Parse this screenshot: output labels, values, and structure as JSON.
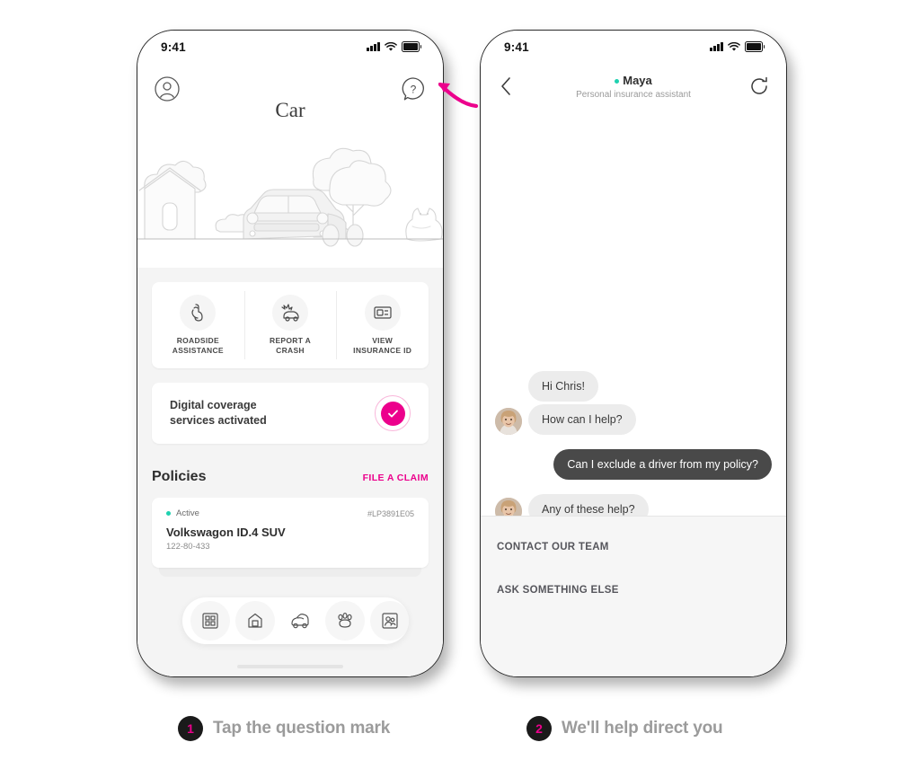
{
  "accent": {
    "pink": "#ec008c",
    "teal": "#1fd1b0",
    "dark": "#494949",
    "caption_gray": "#9b9b9b"
  },
  "phone_left": {
    "status": {
      "time": "9:41",
      "signal_icon": "signal-bars-icon",
      "wifi_icon": "wifi-icon",
      "battery_icon": "battery-icon"
    },
    "header": {
      "avatar_icon": "account-circle-icon",
      "help_icon": "question-mark-bubble-icon",
      "title": "Car"
    },
    "illustration": "car-house-tree-dog-line-art",
    "tiles": [
      {
        "icon": "tow-hook-icon",
        "line1": "ROADSIDE",
        "line2": "ASSISTANCE"
      },
      {
        "icon": "crashed-car-icon",
        "line1": "REPORT A",
        "line2": "CRASH"
      },
      {
        "icon": "insurance-card-icon",
        "line1": "VIEW",
        "line2": "INSURANCE ID"
      }
    ],
    "banner": {
      "line1": "Digital coverage",
      "line2": "services activated",
      "icon": "check-circle-icon"
    },
    "policies": {
      "title": "Policies",
      "action": "FILE A CLAIM",
      "items": [
        {
          "status": "Active",
          "number": "#LP3891E05",
          "name": "Volkswagon ID.4 SUV",
          "sub": "122-80-433"
        }
      ]
    },
    "tabs": [
      {
        "icon": "dashboard-grid-icon",
        "active": false
      },
      {
        "icon": "home-icon",
        "active": false
      },
      {
        "icon": "car-icon",
        "active": true
      },
      {
        "icon": "paw-icon",
        "active": false
      },
      {
        "icon": "family-photo-icon",
        "active": false
      },
      {
        "icon": "partial-tab-icon",
        "active": false
      }
    ]
  },
  "phone_right": {
    "status": {
      "time": "9:41",
      "signal_icon": "signal-bars-icon",
      "wifi_icon": "wifi-icon",
      "battery_icon": "battery-icon"
    },
    "header": {
      "back_icon": "chevron-left-icon",
      "history_icon": "restart-history-icon",
      "title": "Maya",
      "subtitle": "Personal insurance assistant"
    },
    "messages": [
      {
        "from": "agent",
        "text": "Hi Chris!",
        "avatar": false
      },
      {
        "from": "agent",
        "text": "How can I help?",
        "avatar": true
      },
      {
        "from": "user",
        "text": "Can I exclude a driver from my policy?",
        "avatar": false
      },
      {
        "from": "agent",
        "text": "Any of these help?",
        "avatar": true
      }
    ],
    "options": [
      "CONTACT OUR TEAM",
      "ASK SOMETHING ELSE"
    ]
  },
  "annotation": {
    "arrow_icon": "curved-arrow-left-icon"
  },
  "captions": [
    {
      "number": "1",
      "text": "Tap the question mark"
    },
    {
      "number": "2",
      "text": "We'll help direct you"
    }
  ]
}
